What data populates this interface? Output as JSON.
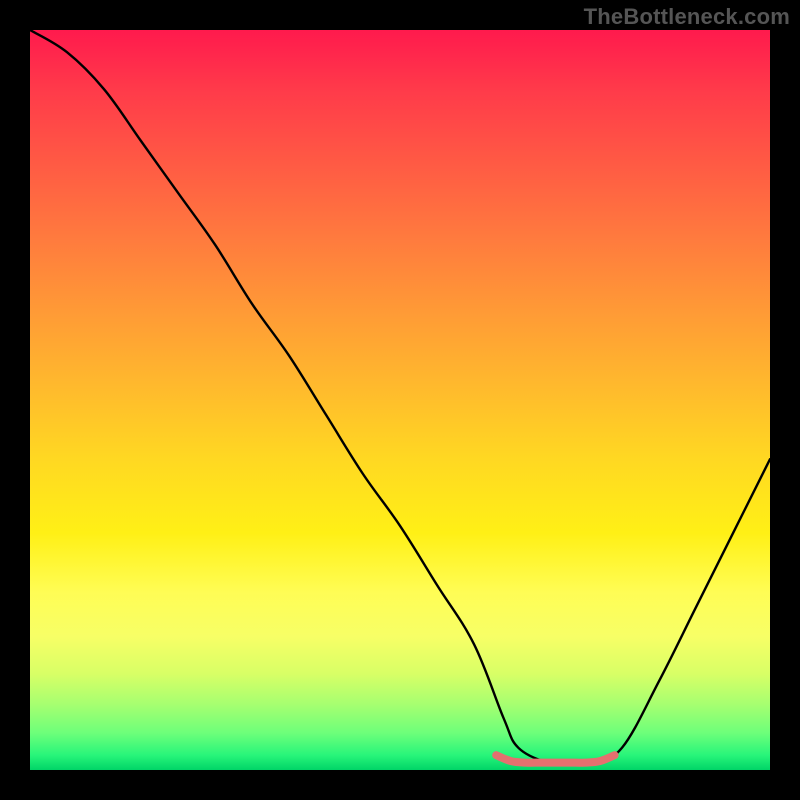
{
  "watermark": "TheBottleneck.com",
  "chart_data": {
    "type": "line",
    "title": "",
    "xlabel": "",
    "ylabel": "",
    "xlim": [
      0,
      100
    ],
    "ylim": [
      0,
      100
    ],
    "grid": false,
    "legend": false,
    "background": "rainbow-gradient",
    "series": [
      {
        "name": "main-curve",
        "color": "#000000",
        "x": [
          0,
          5,
          10,
          15,
          20,
          25,
          30,
          35,
          40,
          45,
          50,
          55,
          60,
          64,
          66,
          70,
          73,
          76,
          80,
          85,
          90,
          95,
          100
        ],
        "values": [
          100,
          97,
          92,
          85,
          78,
          71,
          63,
          56,
          48,
          40,
          33,
          25,
          17,
          7,
          3,
          1,
          1,
          1,
          3,
          12,
          22,
          32,
          42
        ]
      },
      {
        "name": "flat-highlight",
        "color": "#e4706f",
        "x": [
          63,
          65,
          67,
          69,
          71,
          73,
          75,
          77,
          79
        ],
        "values": [
          2,
          1.2,
          1,
          1,
          1,
          1,
          1,
          1.2,
          2
        ]
      }
    ]
  }
}
